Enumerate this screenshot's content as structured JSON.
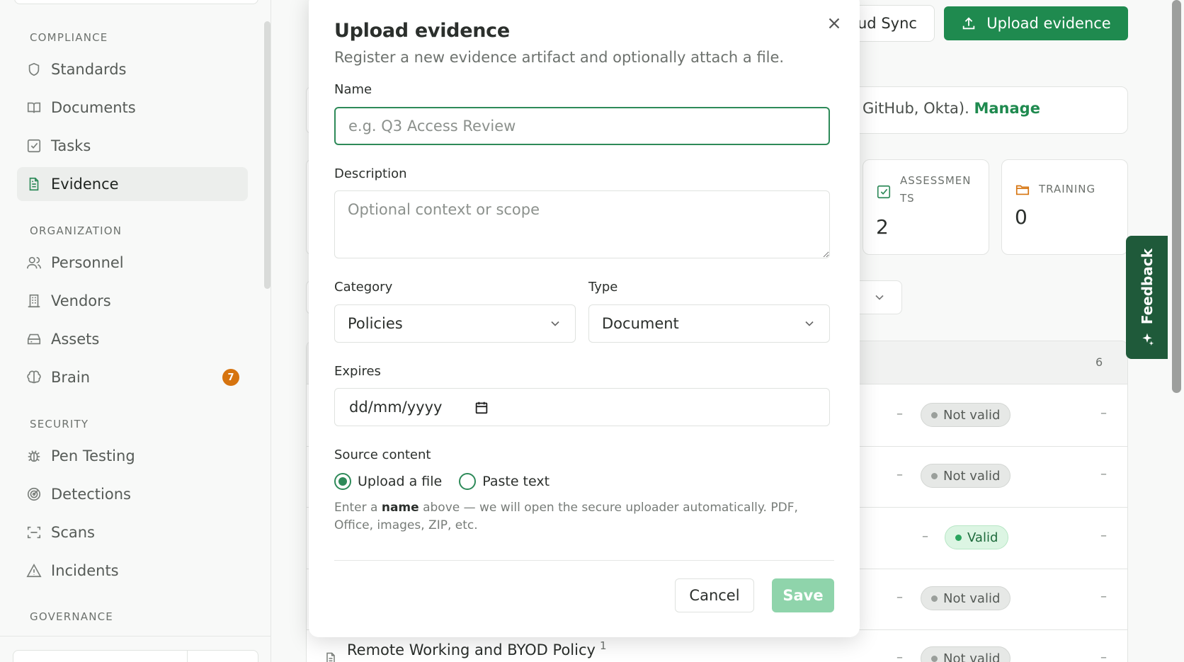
{
  "sidebar": {
    "sections": [
      {
        "title": "COMPLIANCE",
        "items": [
          {
            "label": "Standards",
            "icon": "shield-icon"
          },
          {
            "label": "Documents",
            "icon": "book-icon"
          },
          {
            "label": "Tasks",
            "icon": "checkbox-icon"
          },
          {
            "label": "Evidence",
            "icon": "file-icon",
            "active": true
          }
        ]
      },
      {
        "title": "ORGANIZATION",
        "items": [
          {
            "label": "Personnel",
            "icon": "users-icon"
          },
          {
            "label": "Vendors",
            "icon": "building-icon"
          },
          {
            "label": "Assets",
            "icon": "drive-icon"
          },
          {
            "label": "Brain",
            "icon": "brain-icon",
            "badge": "7"
          }
        ]
      },
      {
        "title": "SECURITY",
        "items": [
          {
            "label": "Pen Testing",
            "icon": "bug-icon"
          },
          {
            "label": "Detections",
            "icon": "radar-icon"
          },
          {
            "label": "Scans",
            "icon": "scan-icon"
          },
          {
            "label": "Incidents",
            "icon": "alert-triangle-icon"
          }
        ]
      },
      {
        "title": "GOVERNANCE",
        "items": []
      }
    ]
  },
  "header": {
    "cloud_sync_label": "ud Sync",
    "upload_label": "Upload evidence"
  },
  "info": {
    "text": "GitHub, Okta).",
    "manage_link": "Manage"
  },
  "stats": [
    {
      "label": "ASSESSMEN TS",
      "value": "2",
      "icon": "checkbox-icon"
    },
    {
      "label": "TRAINING",
      "value": "0",
      "icon": "folder-icon"
    }
  ],
  "table": {
    "count": "6",
    "rows": [
      {
        "status": "Not valid",
        "valid": false
      },
      {
        "status": "Not valid",
        "valid": false
      },
      {
        "status": "Valid",
        "valid": true
      },
      {
        "status": "Not valid",
        "valid": false
      },
      {
        "status": "Not valid",
        "valid": false,
        "title": "Remote Working and BYOD Policy",
        "count": "1"
      }
    ],
    "dash": "–"
  },
  "feedback_label": "Feedback",
  "modal": {
    "title": "Upload evidence",
    "subtitle": "Register a new evidence artifact and optionally attach a file.",
    "name_label": "Name",
    "name_placeholder": "e.g. Q3 Access Review",
    "description_label": "Description",
    "description_placeholder": "Optional context or scope",
    "category_label": "Category",
    "category_value": "Policies",
    "type_label": "Type",
    "type_value": "Document",
    "expires_label": "Expires",
    "expires_placeholder": "dd/mm/yyyy",
    "source_label": "Source content",
    "source_options": [
      {
        "label": "Upload a file",
        "selected": true
      },
      {
        "label": "Paste text",
        "selected": false
      }
    ],
    "hint_pre": "Enter a",
    "hint_bold": "name",
    "hint_post": "above — we will open the secure uploader automatically. PDF, Office, images, ZIP, etc.",
    "cancel_label": "Cancel",
    "save_label": "Save"
  },
  "colors": {
    "brand": "#1f8a4f",
    "badge": "#d6740f",
    "feedback": "#1f5a3a"
  }
}
